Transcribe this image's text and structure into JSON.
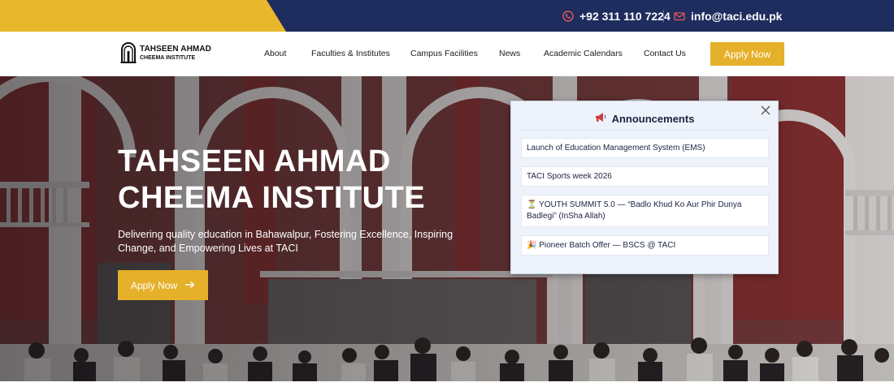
{
  "topbar": {
    "phone": "+92 311 110 7224",
    "email": "info@taci.edu.pk",
    "phone_icon": "phone-icon",
    "email_icon": "envelope-icon",
    "colors": {
      "navy": "#1e2d5e",
      "yellow": "#e8b72c"
    }
  },
  "brand": {
    "line1": "TAHSEEN AHMAD",
    "line2": "CHEEMA INSTITUTE",
    "logo_icon": "arch-logo-icon"
  },
  "nav": {
    "items": [
      {
        "label": "About"
      },
      {
        "label": "Faculties & Institutes"
      },
      {
        "label": "Campus Facilities"
      },
      {
        "label": "News"
      },
      {
        "label": "Academic Calendars"
      },
      {
        "label": "Contact Us"
      }
    ],
    "apply_label": "Apply Now"
  },
  "hero": {
    "title_line1": "TAHSEEN AHMAD",
    "title_line2": "CHEEMA INSTITUTE",
    "subtitle": "Delivering quality education in Bahawalpur, Fostering Excellence, Inspiring Change, and Empowering Lives at TACI",
    "cta_label": "Apply Now",
    "cta_icon": "arrow-right-icon"
  },
  "announcements": {
    "title": "Announcements",
    "title_icon": "megaphone-icon",
    "close_icon": "close-icon",
    "items": [
      {
        "text": "Launch of Education Management System (EMS)"
      },
      {
        "text": "TACI Sports week 2026"
      },
      {
        "text": "⏳ YOUTH SUMMIT 5.0 — “Badlo Khud Ko Aur Phir Dunya Badlegi” (InSha Allah)"
      },
      {
        "text": "🎉 Pioneer Batch Offer — BSCS @ TACI"
      }
    ]
  }
}
